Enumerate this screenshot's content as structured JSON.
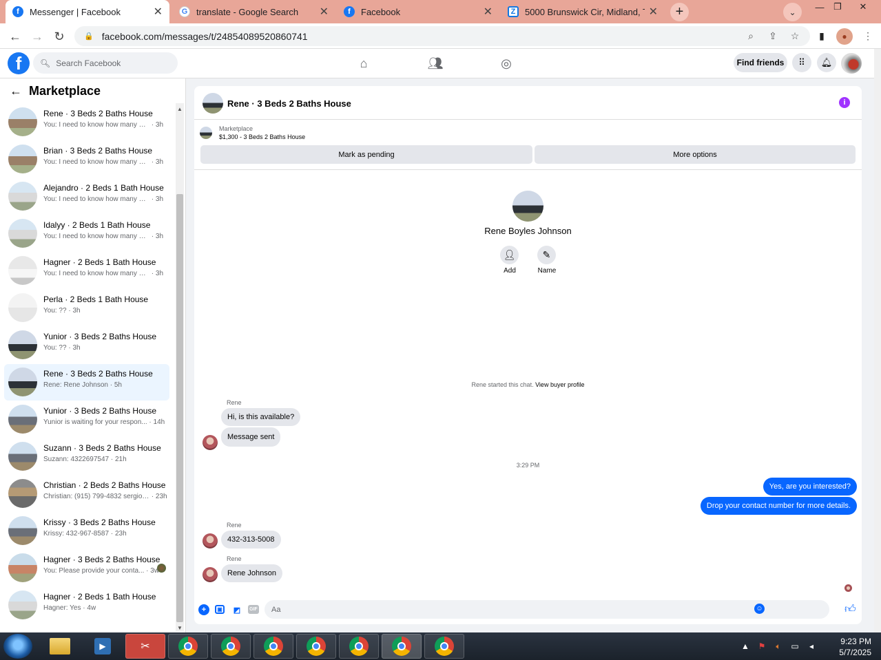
{
  "browser": {
    "tabs": [
      {
        "label": "Messenger | Facebook",
        "icon": "facebook-icon"
      },
      {
        "label": "translate - Google Search",
        "icon": "google-icon"
      },
      {
        "label": "Facebook",
        "icon": "facebook-icon"
      },
      {
        "label": "5000 Brunswick Cir, Midland, TX",
        "icon": "zillow-icon"
      }
    ],
    "url": "facebook.com/messages/t/24854089520860741"
  },
  "fb": {
    "search_placeholder": "Search Facebook",
    "find_friends": "Find friends"
  },
  "sidebar": {
    "title": "Marketplace",
    "conversations": [
      {
        "title": "Rene · 3 Beds 2 Baths House",
        "snippet": "You: I need to know how many m...",
        "time": " · 3h",
        "thumb": "h1"
      },
      {
        "title": "Brian · 3 Beds 2 Baths House",
        "snippet": "You: I need to know how many m...",
        "time": " · 3h",
        "thumb": "h1"
      },
      {
        "title": "Alejandro · 2 Beds 1 Bath House",
        "snippet": "You: I need to know how many m...",
        "time": " · 3h",
        "thumb": "h2"
      },
      {
        "title": "Idalyy · 2 Beds 1 Bath House",
        "snippet": "You: I need to know how many m...",
        "time": " · 3h",
        "thumb": "h2"
      },
      {
        "title": "Hagner · 2 Beds 1 Bath House",
        "snippet": "You: I need to know how many m...",
        "time": " · 3h",
        "thumb": "h3"
      },
      {
        "title": "Perla · 2 Beds 1 Bath House",
        "snippet": "You: ??",
        "time": " · 3h",
        "thumb": "h4"
      },
      {
        "title": "Yunior · 3 Beds 2 Baths House",
        "snippet": "You: ??",
        "time": " · 3h",
        "thumb": "h5"
      },
      {
        "title": "Rene · 3 Beds 2 Baths House",
        "snippet": "Rene: Rene Johnson",
        "time": " · 5h",
        "thumb": "h5"
      },
      {
        "title": "Yunior · 3 Beds 2 Baths House",
        "snippet": "Yunior is waiting for your respon...",
        "time": " · 14h",
        "thumb": "h6"
      },
      {
        "title": "Suzann · 3 Beds 2 Baths House",
        "snippet": "Suzann: 4322697547",
        "time": " · 21h",
        "thumb": "h6"
      },
      {
        "title": "Christian · 2 Beds 2 Baths House",
        "snippet": "Christian: (915) 799-4832 sergio ...",
        "time": " · 23h",
        "thumb": "h7"
      },
      {
        "title": "Krissy · 3 Beds 2 Baths House",
        "snippet": "Krissy: 432-967-8587",
        "time": " · 23h",
        "thumb": "h6"
      },
      {
        "title": "Hagner · 3 Beds 2 Baths House",
        "snippet": "You: Please provide your conta...",
        "time": " · 3w",
        "thumb": "h8"
      },
      {
        "title": "Hagner · 2 Beds 1 Bath House",
        "snippet": "Hagner: Yes",
        "time": " · 4w",
        "thumb": "h2"
      }
    ]
  },
  "chat": {
    "title": "Rene · 3 Beds 2 Baths House",
    "marketplace_label": "Marketplace",
    "listing": "$1,300 - 3 Beds 2 Baths House",
    "mark_pending": "Mark as pending",
    "more_options": "More options",
    "contact_name": "Rene Boyles Johnson",
    "add_label": "Add",
    "name_label": "Name",
    "started_text": "Rene started this chat.",
    "view_profile": "View buyer profile",
    "sender": "Rene",
    "msg1": "Hi, is this available?",
    "msg2": "Message sent",
    "timestamp": "3:29 PM",
    "out1": "Yes, are you interested?",
    "out2": "Drop your contact number for more details.",
    "msg3": "432-313-5008",
    "msg4": "Rene Johnson",
    "composer_placeholder": "Aa"
  },
  "taskbar": {
    "time": "9:23 PM",
    "date": "5/7/2025"
  }
}
